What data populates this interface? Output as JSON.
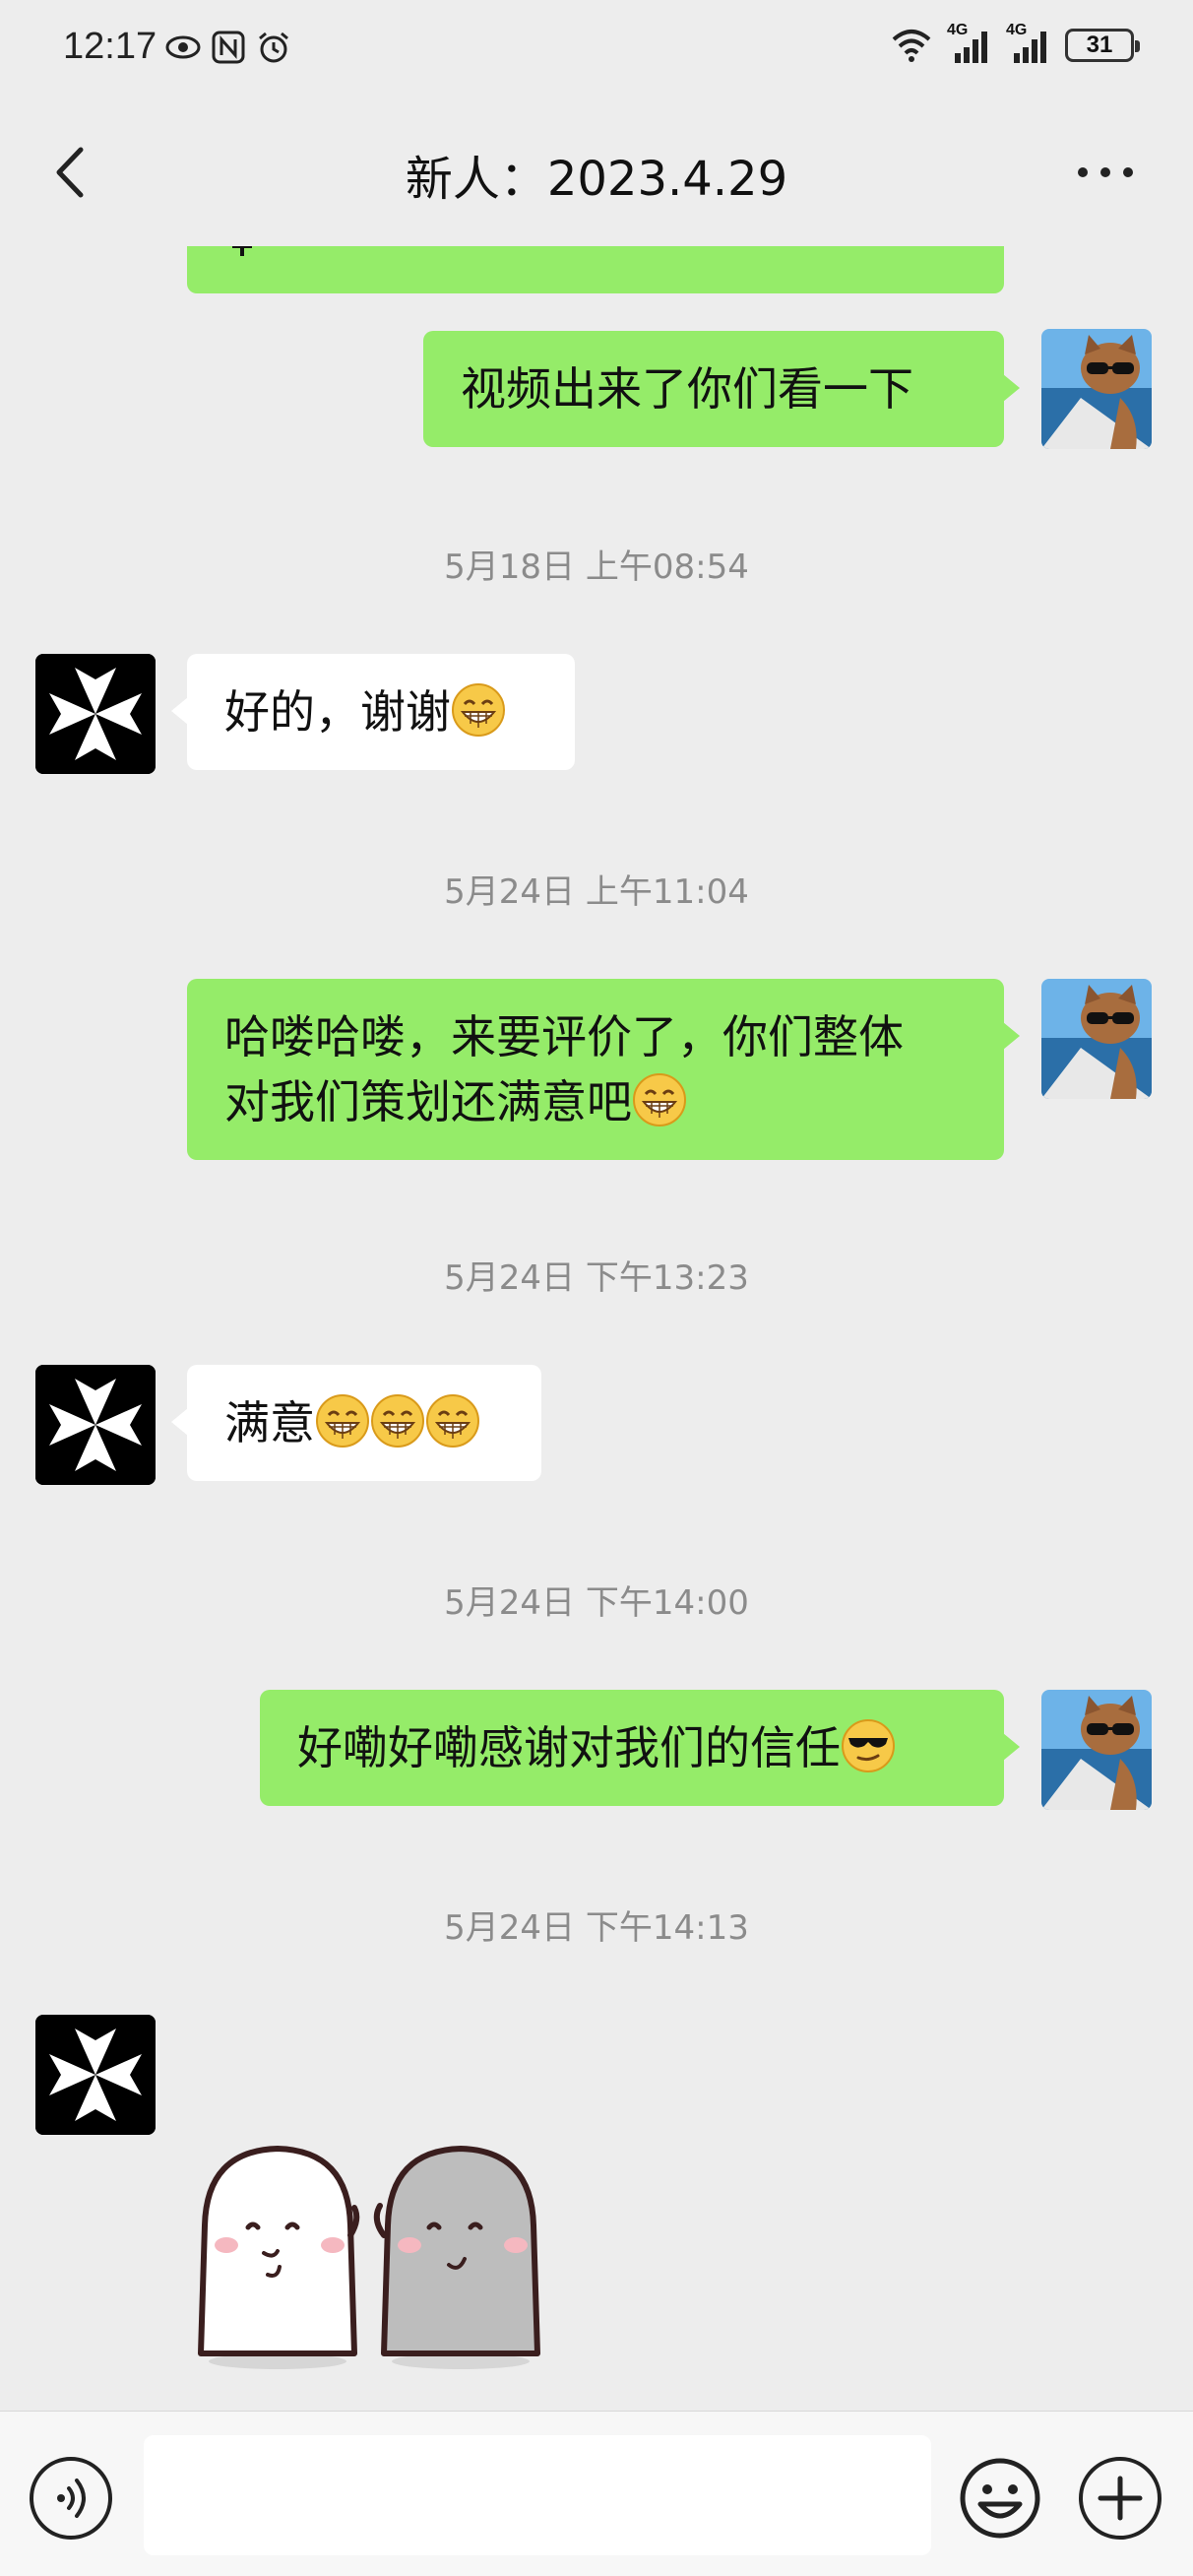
{
  "status_bar": {
    "time": "12:17",
    "network_1": "4G",
    "network_2": "4G",
    "battery": "31"
  },
  "header": {
    "title": "新人：2023.4.29"
  },
  "messages": [
    {
      "from": "me",
      "text": "视频出来了你们看一下"
    },
    {
      "timestamp": "5月18日 上午08:54"
    },
    {
      "from": "other",
      "text": "好的，谢谢"
    },
    {
      "timestamp": "5月24日 上午11:04"
    },
    {
      "from": "me",
      "line1": "哈喽哈喽，来要评价了，你们整体",
      "line2": "对我们策划还满意吧"
    },
    {
      "timestamp": "5月24日 下午13:23"
    },
    {
      "from": "other",
      "text": "满意"
    },
    {
      "timestamp": "5月24日 下午14:00"
    },
    {
      "from": "me",
      "text": "好嘞好嘞感谢对我们的信任"
    },
    {
      "timestamp": "5月24日 下午14:13"
    },
    {
      "from": "other",
      "sticker": "two-ghost-sticker"
    }
  ],
  "icons": {
    "back": "chevron-left-icon",
    "more": "more-dots-icon",
    "voice": "voice-icon",
    "emoji": "emoji-icon",
    "plus": "plus-icon",
    "grin": "grin-emoji",
    "cool": "sunglasses-emoji"
  },
  "colors": {
    "my_bubble": "#95ec69",
    "other_bubble": "#ffffff",
    "background": "#ededed",
    "timestamp": "#8b8b8b"
  }
}
